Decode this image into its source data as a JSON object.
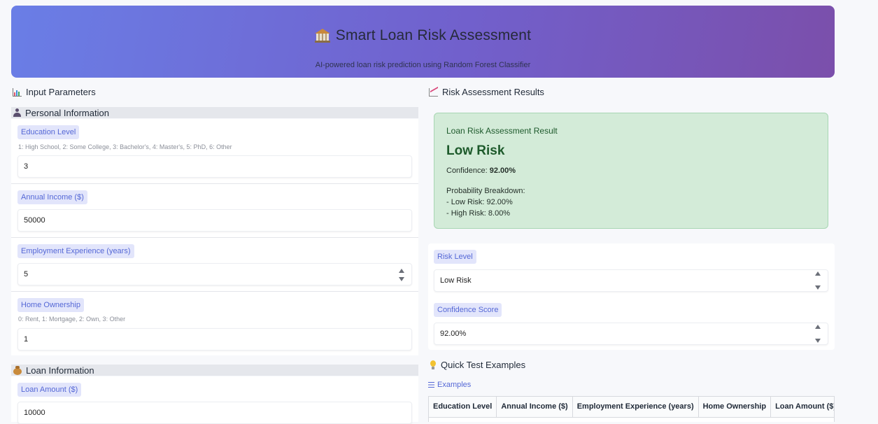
{
  "header": {
    "title": "Smart Loan Risk Assessment",
    "subtitle": "AI-powered loan risk prediction using Random Forest Classifier",
    "icon": "bank-icon"
  },
  "input_section": {
    "title": "Input Parameters",
    "icon": "bar-chart-icon"
  },
  "personal": {
    "title": "Personal Information",
    "icon": "person-icon",
    "education": {
      "label": "Education Level",
      "info": "1: High School, 2: Some College, 3: Bachelor's, 4: Master's, 5: PhD, 6: Other",
      "value": "3"
    },
    "income": {
      "label": "Annual Income ($)",
      "value": "50000"
    },
    "experience": {
      "label": "Employment Experience (years)",
      "value": "5"
    },
    "ownership": {
      "label": "Home Ownership",
      "info": "0: Rent, 1: Mortgage, 2: Own, 3: Other",
      "value": "1"
    }
  },
  "loan": {
    "title": "Loan Information",
    "icon": "money-bag-icon",
    "amount": {
      "label": "Loan Amount ($)",
      "value": "10000"
    }
  },
  "results_section": {
    "title": "Risk Assessment Results",
    "icon": "trend-chart-icon"
  },
  "result": {
    "heading": "Loan Risk Assessment Result",
    "level": "Low Risk",
    "confidence_label": "Confidence: ",
    "confidence_value": "92.00%",
    "breakdown_title": "Probability Breakdown:",
    "low_risk_line": "- Low Risk: 92.00%",
    "high_risk_line": "- High Risk: 8.00%",
    "background_color": "#d3ebd8"
  },
  "outputs": {
    "risk_level": {
      "label": "Risk Level",
      "value": "Low Risk"
    },
    "confidence": {
      "label": "Confidence Score",
      "value": "92.00%"
    }
  },
  "examples": {
    "title": "Quick Test Examples",
    "icon": "light-bulb-icon",
    "link_label": "Examples",
    "columns": [
      "Education Level",
      "Annual Income ($)",
      "Employment Experience (years)",
      "Home Ownership",
      "Loan Amount ($)"
    ]
  },
  "colors": {
    "accent": "#5568d6",
    "header_gradient_start": "#6a7ee6",
    "header_gradient_end": "#7b4fab"
  }
}
